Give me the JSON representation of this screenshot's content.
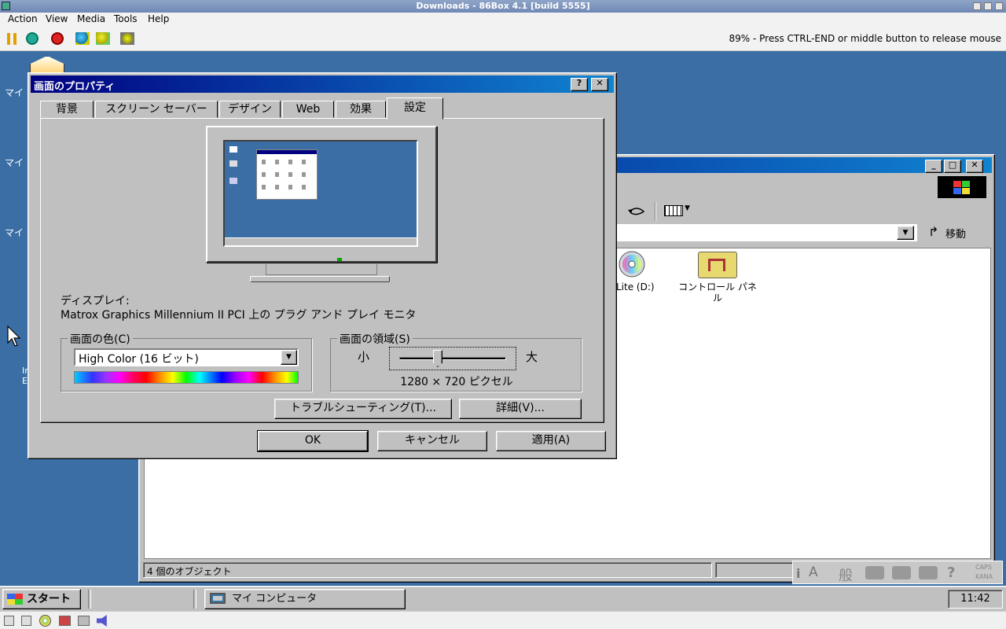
{
  "host": {
    "title": "Downloads - 86Box 4.1 [build 5555]",
    "menu": [
      "Action",
      "View",
      "Media",
      "Tools",
      "Help"
    ],
    "status": "89% - Press CTRL-END or middle button to release mouse"
  },
  "desktop": {
    "icon_labels": [
      "マイ",
      "マイ",
      "マイ",
      "In",
      "E"
    ]
  },
  "explorer": {
    "title": "マイ コンピュータ",
    "address_button": "移動",
    "status_text": "4 個のオブジェクト",
    "items": [
      {
        "label": "Lite (D:)"
      },
      {
        "label": "コントロール パネ\nル"
      }
    ]
  },
  "dialog": {
    "title": "画面のプロパティ",
    "help_label": "?",
    "close_label": "✕",
    "tabs": [
      "背景",
      "スクリーン セーバー",
      "デザイン",
      "Web",
      "効果",
      "設定"
    ],
    "active_tab": "設定",
    "display_label": "ディスプレイ:",
    "display_name": "Matrox Graphics Millennium II PCI 上の プラグ アンド プレイ モニタ",
    "color_group": "画面の色(C)",
    "color_value": "High Color (16 ビット)",
    "area_group": "画面の領域(S)",
    "area_min": "小",
    "area_max": "大",
    "resolution": "1280 × 720 ピクセル",
    "slider_position": 0.36,
    "troubleshoot_button": "トラブルシューティング(T)...",
    "advanced_button": "詳細(V)...",
    "ok_button": "OK",
    "cancel_button": "キャンセル",
    "apply_button": "適用(A)"
  },
  "taskbar": {
    "start_label": "スタート",
    "task_label": "マイ コンピュータ",
    "clock": "11:42",
    "ime_general": "般",
    "ime_caps": "CAPS",
    "ime_kana": "KANA"
  },
  "colors": {
    "desktop": "#3a6ea5",
    "title_active": "#000080",
    "title_gradient": "#1084d0",
    "face": "#c0c0c0"
  }
}
